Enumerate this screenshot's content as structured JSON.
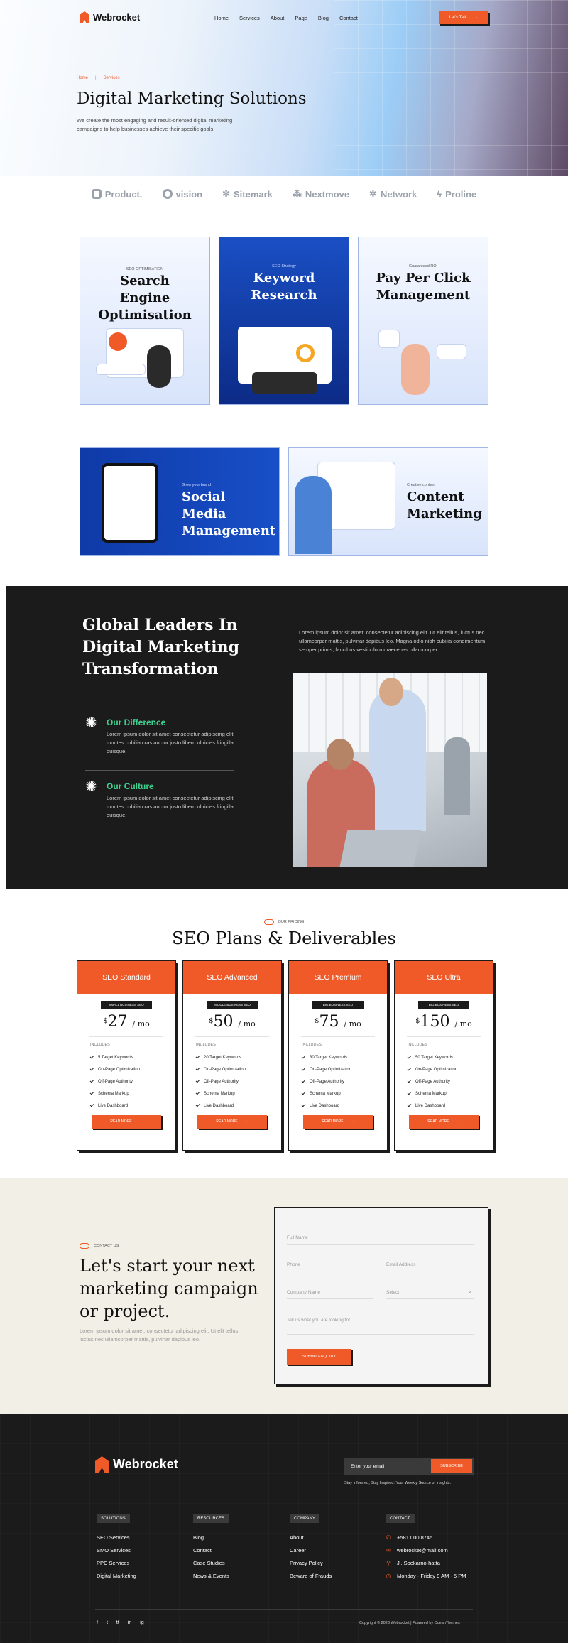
{
  "brand": {
    "name": "Webrocket"
  },
  "nav": {
    "items": [
      "Home",
      "Services",
      "About",
      "Page",
      "Blog",
      "Contact"
    ],
    "cta": "Let's Talk"
  },
  "hero": {
    "breadcrumb": [
      "Home",
      "Services"
    ],
    "breadcrumb_sep": "|",
    "title": "Digital Marketing Solutions",
    "lead": "We create the most engaging and result-oriented digital marketing campaigns to help businesses achieve their specific goals."
  },
  "logos": [
    "Product.",
    "vision",
    "Sitemark",
    "Nextmove",
    "Network",
    "Proline"
  ],
  "services": [
    {
      "eyebrow": "SEO OPTIMISATION",
      "title": "Search Engine Optimisation"
    },
    {
      "eyebrow": "SEO Strategy",
      "title": "Keyword Research"
    },
    {
      "eyebrow": "Guaranteed ROI",
      "title": "Pay Per Click Management"
    },
    {
      "eyebrow": "Grow your brand",
      "title": "Social Media Management"
    },
    {
      "eyebrow": "Creative content",
      "title": "Content Marketing"
    }
  ],
  "leaders": {
    "title": "Global Leaders In Digital Marketing Transformation",
    "desc": "Lorem ipsum dolor sit amet, consectetur adipiscing elit. Ut elit tellus, luctus nec ullamcorper mattis, pulvinar dapibus leo. Magna odio nibh cubilia condimentum semper primis, faucibus vestibulum maecenas ullamcorper",
    "features": [
      {
        "title": "Our Difference",
        "text": "Lorem ipsum dolor sit amet consectetur adipiscing elit montes cubilia cras auctor justo libero ultricies fringilla quisque."
      },
      {
        "title": "Our Culture",
        "text": "Lorem ipsum dolor sit amet consectetur adipiscing elit montes cubilia cras auctor justo libero ultricies fringilla quisque."
      }
    ]
  },
  "pricing": {
    "eyebrow": "OUR PRICING",
    "title": "SEO Plans & Deliverables",
    "includes_label": "INCLUDES",
    "button": "READ MORE",
    "plans": [
      {
        "name": "SEO Standard",
        "badge": "SMALL BUSINESS SEO",
        "currency": "$",
        "price": "27",
        "period": "/ mo",
        "features": [
          "5 Target Keywords",
          "On-Page Optimization",
          "Off-Page Authority",
          "Schema Markup",
          "Live Dashboard"
        ]
      },
      {
        "name": "SEO Advanced",
        "badge": "MIDDLE BUSINESS SEO",
        "currency": "$",
        "price": "50",
        "period": "/ mo",
        "features": [
          "20 Target Keywords",
          "On-Page Optimization",
          "Off-Page Authority",
          "Schema Markup",
          "Live Dashboard"
        ]
      },
      {
        "name": "SEO Premium",
        "badge": "BIG BUSINESS SEO",
        "currency": "$",
        "price": "75",
        "period": "/ mo",
        "features": [
          "30 Target Keywords",
          "On-Page Optimization",
          "Off-Page Authority",
          "Schema Markup",
          "Live Dashboard"
        ]
      },
      {
        "name": "SEO Ultra",
        "badge": "BIG BUSINESS SEO",
        "currency": "$",
        "price": "150",
        "period": "/ mo",
        "features": [
          "50 Target Keywords",
          "On-Page Optimization",
          "Off-Page Authority",
          "Schema Markup",
          "Live Dashboard"
        ]
      }
    ]
  },
  "contact": {
    "eyebrow": "CONTACT US",
    "title": "Let's start your next marketing campaign or project.",
    "desc": "Lorem ipsum dolor sit amet, consectetur adipiscing elit. Ut elit tellus, luctus nec ullamcorper mattis, pulvinar dapibus leo.",
    "form": {
      "full_name": "Full Name",
      "phone": "Phone",
      "email": "Email Address",
      "company": "Company Name",
      "select": "Select",
      "message": "Tell us what you are looking for",
      "submit": "SUBMIT ENQUIRY"
    }
  },
  "footer": {
    "newsletter_placeholder": "Enter your email",
    "subscribe": "SUBSCRIBE",
    "newsletter_note": "Stay Informed, Stay Inspired: Your Weekly Source of Insights.",
    "columns": [
      {
        "title": "SOLUTIONS",
        "links": [
          "SEO Services",
          "SMO Services",
          "PPC Services",
          "Digital Marketing"
        ]
      },
      {
        "title": "RESOURCES",
        "links": [
          "Blog",
          "Contact",
          "Case Studies",
          "News & Events"
        ]
      },
      {
        "title": "COMPANY",
        "links": [
          "About",
          "Career",
          "Privacy Policy",
          "Beware of Frauds"
        ]
      }
    ],
    "contact": {
      "title": "CONTACT",
      "items": [
        "+581 000 8745",
        "webrocket@mail.com",
        "Jl. Soekarno-hatta",
        "Monday - Friday 9 AM - 5 PM"
      ]
    },
    "social": [
      "f",
      "t",
      "tt",
      "in",
      "ig"
    ],
    "copyright": "Copyright © 2023 Webrocket | Powered by OceanThemes"
  },
  "colors": {
    "accent": "#f05a28",
    "dark": "#1b1b1b",
    "green": "#3fcf8e",
    "cream": "#f2efe6"
  }
}
